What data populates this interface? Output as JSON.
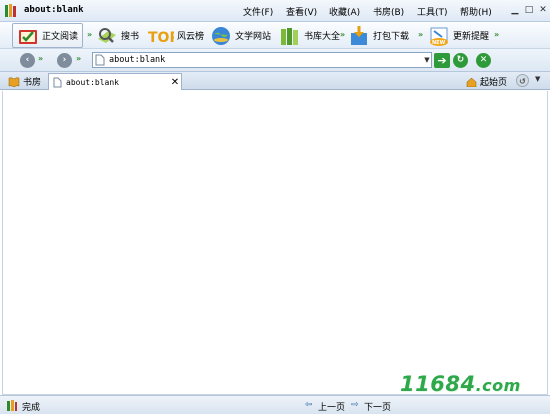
{
  "window": {
    "title": "about:blank"
  },
  "menu": [
    {
      "label": "文件(F)"
    },
    {
      "label": "查看(V)"
    },
    {
      "label": "收藏(A)"
    },
    {
      "label": "书房(B)"
    },
    {
      "label": "工具(T)"
    },
    {
      "label": "帮助(H)"
    }
  ],
  "toolbar": {
    "reading": "正文阅读",
    "search": "搜书",
    "ranking": "风云榜",
    "sites": "文学网站",
    "library": "书库大全",
    "download": "打包下载",
    "update": "更新提醒"
  },
  "address": {
    "url": "about:blank"
  },
  "tabs": {
    "study": "书房",
    "active_tab": "about:blank",
    "home": "起始页"
  },
  "status": {
    "text": "完成",
    "prev": "上一页",
    "next": "下一页"
  },
  "watermark": {
    "main": "11684",
    "domain": ".com"
  },
  "colors": {
    "accent": "#2f8a2f",
    "chrome": "#dfe9f5",
    "border": "#9fb4cc"
  }
}
